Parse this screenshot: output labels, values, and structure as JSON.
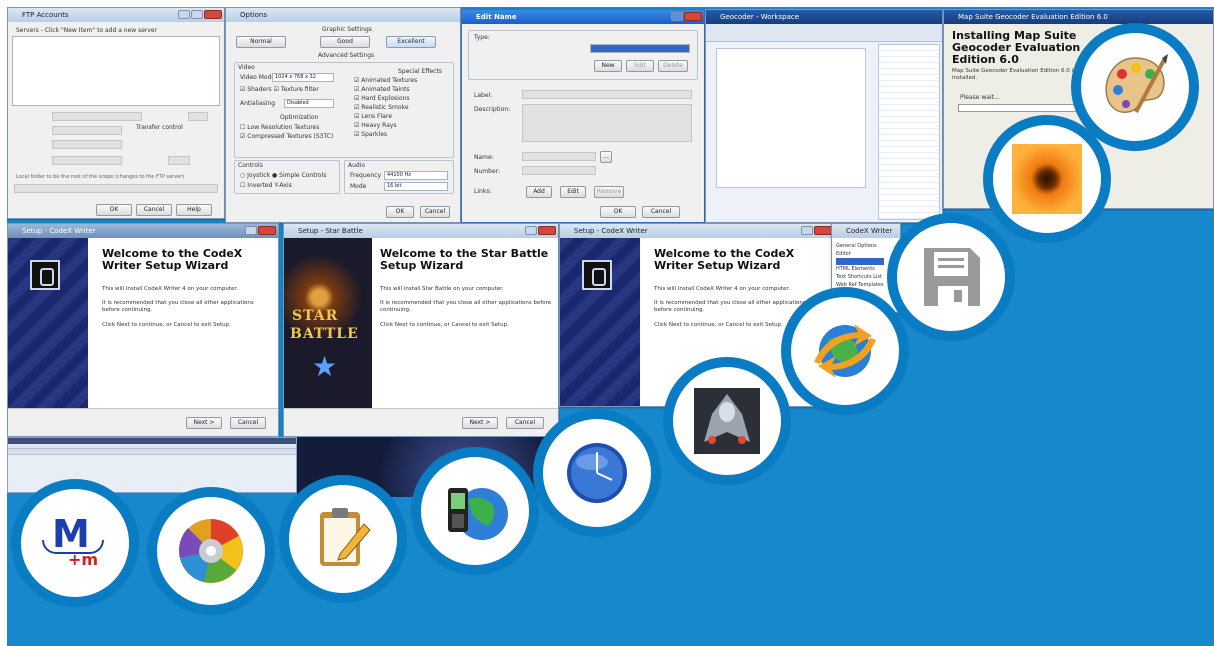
{
  "colors": {
    "background": "#1888cc",
    "circle_ring": "#0a7cc4",
    "circle_fill": "#ffffff"
  },
  "ftp_window": {
    "title": "FTP Accounts",
    "server_hint": "Servers - Click \"New Item\" to add a new server",
    "transfer_label": "Transfer control",
    "bottom_hint": "Local folder to be the root of the scope (changes to the FTP server)",
    "ok": "OK",
    "cancel": "Cancel",
    "help": "Help"
  },
  "options_window": {
    "title": "Options",
    "graphic_settings": "Graphic Settings",
    "quality_buttons": [
      "Normal",
      "Good",
      "Excellent"
    ],
    "advanced_settings": "Advanced Settings",
    "video": "Video",
    "special_effects": "Special Effects",
    "video_mode_label": "Video Mode",
    "video_mode_value": "1024 x 768 x 32",
    "video_checks": [
      "Shaders",
      "Texture filter"
    ],
    "antialiasing_label": "Antialiasing",
    "antialiasing_value": "Disabled",
    "effects_checks": [
      "Animated Textures",
      "Animated Taints",
      "Hard Explosions",
      "Realistic Smoke",
      "Lens Flare",
      "Heavy Rays",
      "Sparkles"
    ],
    "optimization_label": "Optimization",
    "optimization_checks": [
      "Low Resolution Textures",
      "Compressed Textures (S3TC)"
    ],
    "controls_label": "Controls",
    "controls_checks": [
      "Joystick",
      "Simple Controls",
      "Inverted Y-Axis"
    ],
    "audio_label": "Audio",
    "frequency_label": "Frequency",
    "frequency_value": "44100 Hz",
    "mode_label": "Mode",
    "mode_value": "16 bit",
    "ok": "OK",
    "cancel": "Cancel"
  },
  "edit_dialog": {
    "title": "Edit Name",
    "type_label": "Type:",
    "new_btn": "New",
    "edit_btn": "Edit",
    "delete_btn": "Delete",
    "label_label": "Label:",
    "description_label": "Description:",
    "name_label": "Name:",
    "number_label": "Number:",
    "links_label": "Links:",
    "add_btn": "Add",
    "link_edit_btn": "Edit",
    "remove_btn": "Remove",
    "ok": "OK",
    "cancel": "Cancel"
  },
  "ide_window": {
    "title": "Geocoder - Workspace"
  },
  "install_window": {
    "title": "Map Suite Geocoder Evaluation Edition 6.0",
    "heading": "Installing Map Suite Geocoder Evaluation Edition 6.0",
    "subtitle": "Map Suite Geocoder Evaluation Edition 6.0 is being installed.",
    "wait": "Please wait..."
  },
  "codex_setup_1": {
    "title": "Setup - CodeX Writer",
    "heading": "Welcome to the CodeX Writer Setup Wizard",
    "line1": "This will install CodeX Writer 4 on your computer.",
    "line2": "It is recommended that you close all other applications before continuing.",
    "line3": "Click Next to continue, or Cancel to exit Setup.",
    "next": "Next >",
    "cancel": "Cancel"
  },
  "star_setup": {
    "title": "Setup - Star Battle",
    "heading": "Welcome to the Star Battle Setup Wizard",
    "line1": "This will install Star Battle on your computer.",
    "line2": "It is recommended that you close all other applications before continuing.",
    "line3": "Click Next to continue, or Cancel to exit Setup.",
    "art_line1": "STAR",
    "art_line2": "BATTLE",
    "next": "Next >",
    "cancel": "Cancel"
  },
  "codex_setup_2": {
    "title": "Setup - CodeX Writer",
    "heading": "Welcome to the CodeX Writer Setup Wizard",
    "line1": "This will install CodeX Writer 4 on your computer.",
    "line2": "It is recommended that you close all other applications before continuing.",
    "line3": "Click Next to continue, or Cancel to exit Setup."
  },
  "codex_options": {
    "title": "CodeX Writer",
    "items": [
      "General Options",
      "Editor",
      "HTML Elements",
      "Text Shortcuts List",
      "Web Ref Templates"
    ]
  },
  "app_icons": [
    "mathmagic-icon",
    "color-wheel-disc-icon",
    "clipboard-pencil-icon",
    "phone-globe-icon",
    "blue-clock-icon",
    "space-fighter-icon",
    "globe-sync-icon",
    "floppy-disk-icon",
    "orange-flower-photo-icon",
    "paint-palette-icon"
  ],
  "mathmagic": {
    "letter": "M",
    "sub": "+m"
  }
}
